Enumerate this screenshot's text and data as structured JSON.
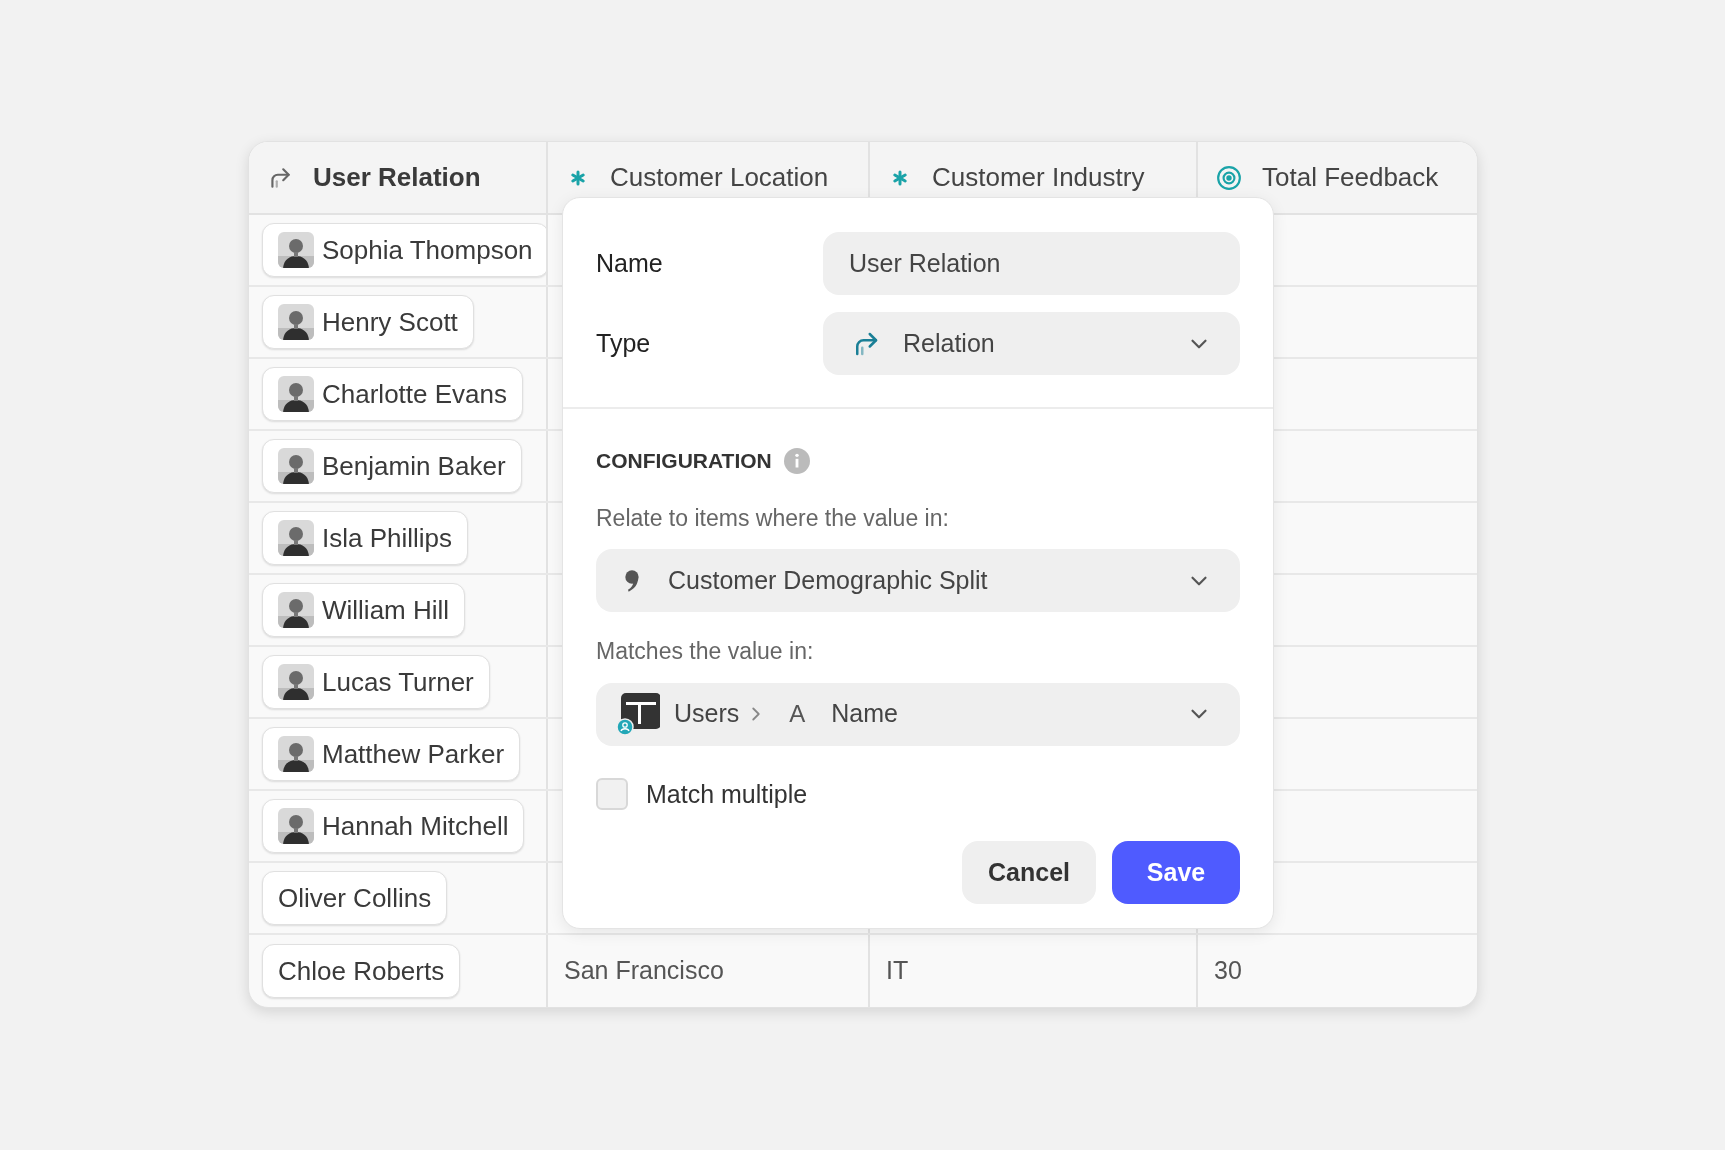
{
  "table": {
    "columns": [
      {
        "label": "User Relation",
        "kind": "relation"
      },
      {
        "label": "Customer Location",
        "kind": "asterisk"
      },
      {
        "label": "Customer Industry",
        "kind": "asterisk"
      },
      {
        "label": "Total Feedback",
        "kind": "target"
      }
    ],
    "rows": [
      {
        "user": "Sophia Thompson"
      },
      {
        "user": "Henry Scott"
      },
      {
        "user": "Charlotte Evans"
      },
      {
        "user": "Benjamin Baker"
      },
      {
        "user": "Isla Phillips"
      },
      {
        "user": "William Hill"
      },
      {
        "user": "Lucas Turner"
      },
      {
        "user": "Matthew Parker"
      },
      {
        "user": "Hannah Mitchell"
      },
      {
        "user": "Oliver Collins"
      },
      {
        "user": "Chloe Roberts",
        "cells": [
          "San Francisco",
          "IT",
          "30"
        ]
      }
    ]
  },
  "popover": {
    "name_label": "Name",
    "name_value": "User Relation",
    "type_label": "Type",
    "type_value": "Relation",
    "section_title": "CONFIGURATION",
    "relate_label": "Relate to items where the value in:",
    "relate_value": "Customer Demographic Split",
    "matches_label": "Matches the value in:",
    "matches_table": "Users",
    "field_icon": "A",
    "matches_field": "Name",
    "match_multiple": {
      "label": "Match multiple",
      "checked": false
    },
    "buttons": [
      {
        "label": "Cancel",
        "kind": "secondary"
      },
      {
        "label": "Save",
        "kind": "primary"
      }
    ]
  }
}
